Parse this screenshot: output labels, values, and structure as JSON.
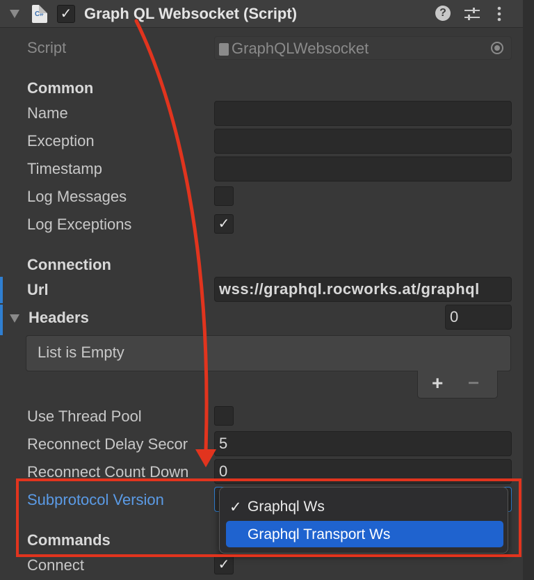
{
  "component": {
    "title": "Graph QL Websocket (Script)",
    "enabled_check": "✓",
    "icon_label": "C#"
  },
  "script_row": {
    "label": "Script",
    "value": "GraphQLWebsocket"
  },
  "common": {
    "heading": "Common",
    "name_label": "Name",
    "exception_label": "Exception",
    "timestamp_label": "Timestamp",
    "log_messages_label": "Log Messages",
    "log_exceptions_label": "Log Exceptions",
    "log_exceptions_check": "✓"
  },
  "connection": {
    "heading": "Connection",
    "url_label": "Url",
    "url_value": "wss://graphql.rocworks.at/graphql",
    "headers_label": "Headers",
    "headers_count": "0",
    "list_empty": "List is Empty",
    "plus": "+",
    "minus": "−",
    "use_thread_pool_label": "Use Thread Pool",
    "reconnect_delay_label": "Reconnect Delay Secor",
    "reconnect_delay_value": "5",
    "reconnect_countdown_label": "Reconnect Count Down",
    "reconnect_countdown_value": "0",
    "subprotocol_label": "Subprotocol Version"
  },
  "dropdown": {
    "options": [
      "Graphql Ws",
      "Graphql Transport Ws"
    ],
    "checkmark": "✓"
  },
  "commands": {
    "heading": "Commands",
    "connect_label": "Connect",
    "connect_check": "✓"
  },
  "colors": {
    "annotation_red": "#e1341e",
    "highlight_blue": "#1f63cf",
    "label_blue": "#5b9be6"
  }
}
